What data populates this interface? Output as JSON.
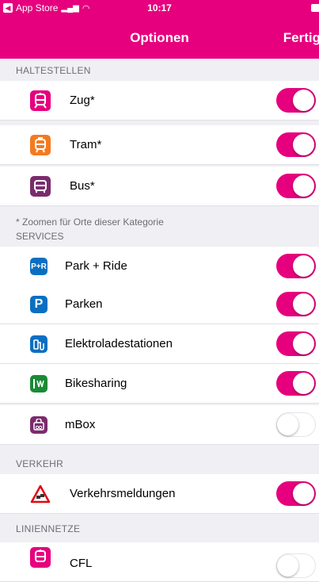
{
  "status_bar": {
    "back_app": "App Store",
    "time": "10:17"
  },
  "nav": {
    "title": "Optionen",
    "done": "Fertig"
  },
  "sections": {
    "haltestellen": "HALTESTELLEN",
    "note": "* Zoomen für Orte dieser Kategorie",
    "services": "SERVICES",
    "verkehr": "VERKEHR",
    "liniennetze": "LINIENNETZE"
  },
  "rows": {
    "zug": {
      "label": "Zug*",
      "on": true
    },
    "tram": {
      "label": "Tram*",
      "on": true
    },
    "bus": {
      "label": "Bus*",
      "on": true
    },
    "park_ride": {
      "label": "Park + Ride",
      "icon_text": "P+R",
      "on": true
    },
    "parken": {
      "label": "Parken",
      "icon_text": "P",
      "on": true
    },
    "elektro": {
      "label": "Elektroladestationen",
      "on": true
    },
    "bikesharing": {
      "label": "Bikesharing",
      "on": true
    },
    "mbox": {
      "label": "mBox",
      "on": false
    },
    "verkehrsmeldungen": {
      "label": "Verkehrsmeldungen",
      "on": true
    },
    "cfl": {
      "label": "CFL",
      "on": false
    }
  },
  "colors": {
    "accent": "#e6007e",
    "train": "#e6007e",
    "tram": "#f47a20",
    "bus": "#7b2b6d",
    "park": "#0a6fc2",
    "bike": "#1a8a35",
    "mbox": "#7b2b6d"
  }
}
